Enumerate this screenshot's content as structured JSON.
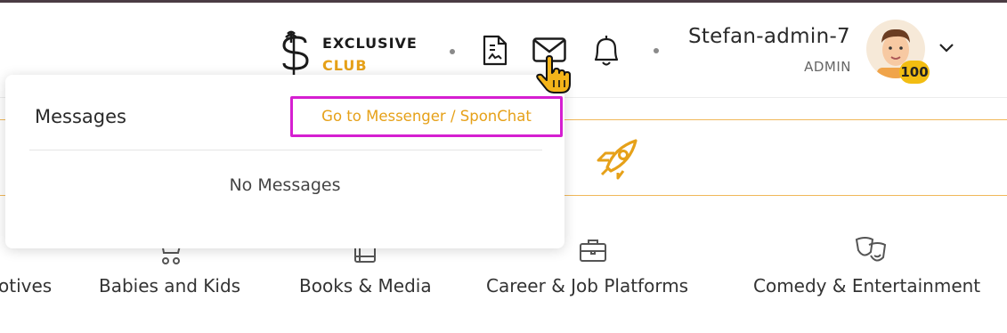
{
  "header": {
    "logo": {
      "line1": "EXCLUSIVE",
      "line2": "CLUB",
      "icon": "palm-s-logo-icon"
    },
    "icons": [
      "document-icon",
      "mail-icon",
      "bell-icon"
    ],
    "user": {
      "name": "Stefan-admin-7",
      "role": "ADMIN",
      "badge": "100"
    }
  },
  "dropdown": {
    "title": "Messages",
    "link": "Go to Messenger / SponChat",
    "empty": "No Messages"
  },
  "categories": [
    {
      "label": "otives",
      "icon": ""
    },
    {
      "label": "Babies and Kids",
      "icon": "stroller-icon"
    },
    {
      "label": "Books & Media",
      "icon": "books-icon"
    },
    {
      "label": "Career & Job Platforms",
      "icon": "briefcase-icon"
    },
    {
      "label": "Comedy & Entertainment",
      "icon": "theater-masks-icon"
    }
  ],
  "colors": {
    "accent": "#e6a119",
    "highlight": "#d51fd1",
    "badge": "#f2bd12"
  }
}
